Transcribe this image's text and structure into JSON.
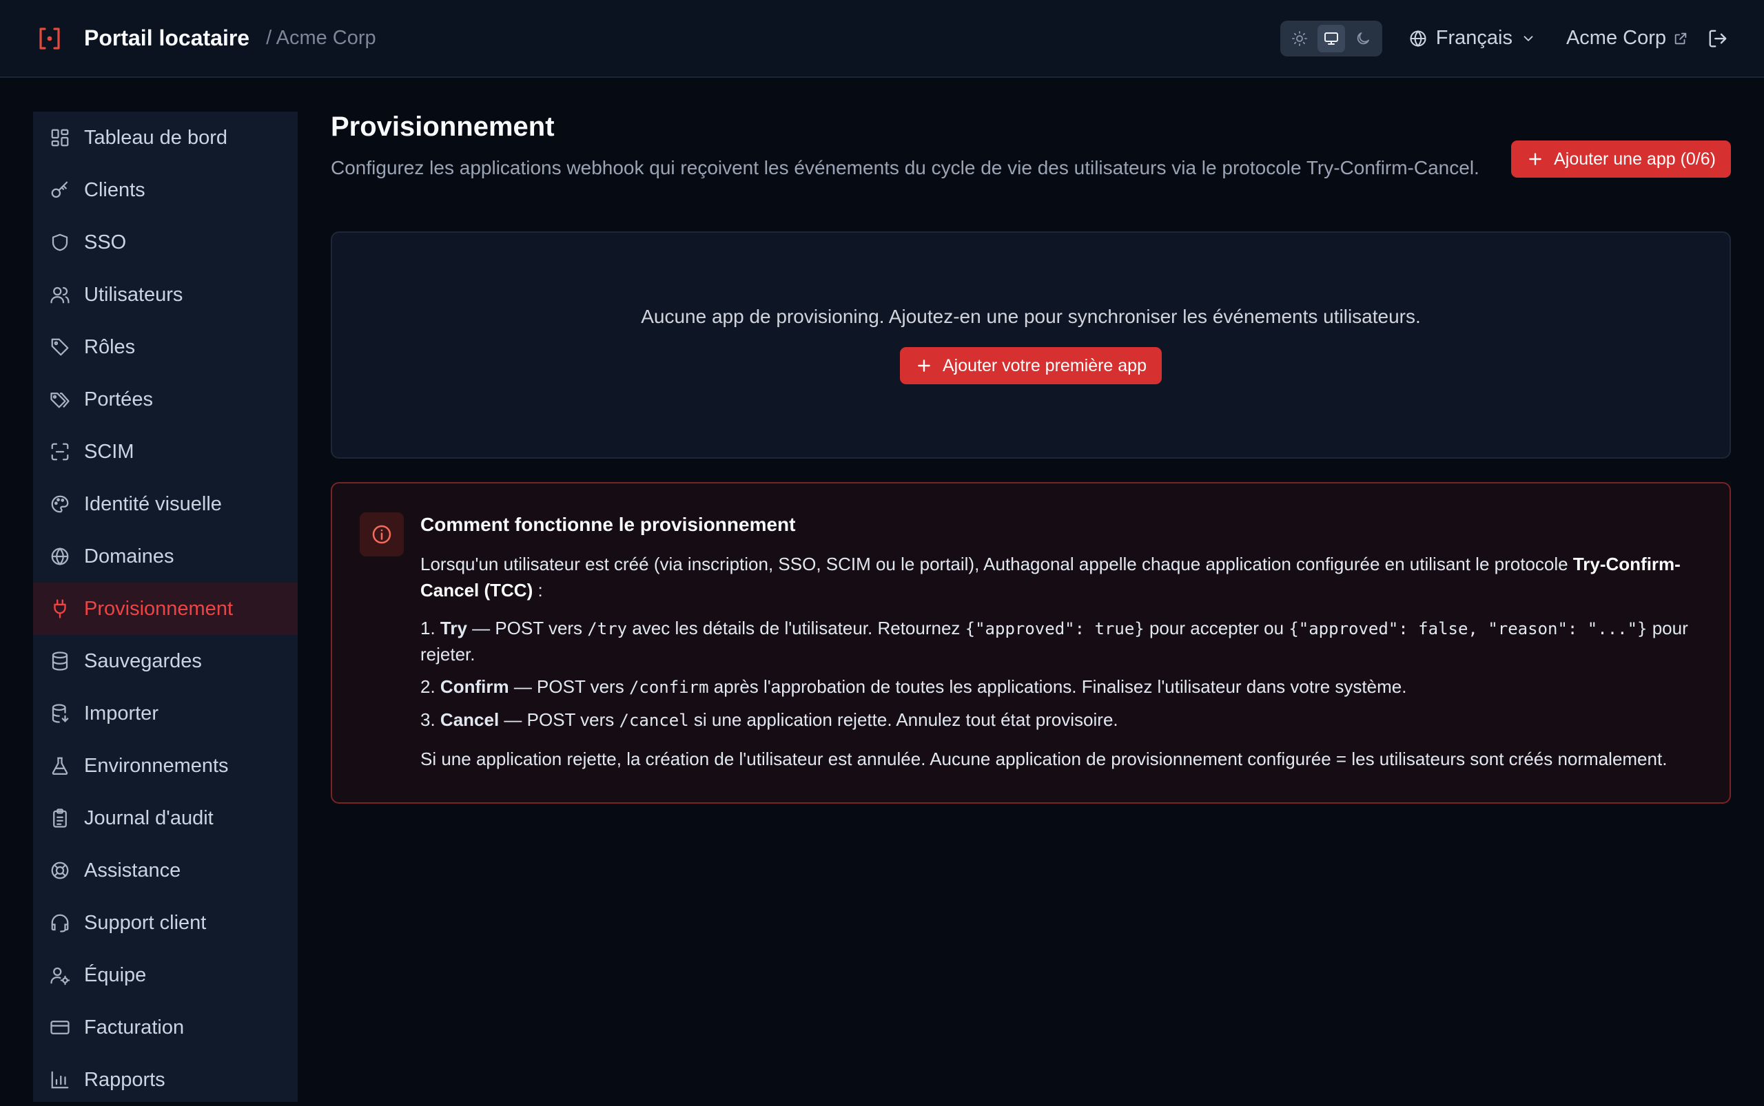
{
  "header": {
    "app_title": "Portail locataire",
    "breadcrumb": "/ Acme Corp",
    "language": "Français",
    "org_link": "Acme Corp",
    "theme_options": [
      "light",
      "system",
      "dark"
    ],
    "theme_selected": "system"
  },
  "sidebar": {
    "items": [
      {
        "label": "Tableau de bord",
        "icon": "dashboard-icon"
      },
      {
        "label": "Clients",
        "icon": "key-icon"
      },
      {
        "label": "SSO",
        "icon": "shield-icon"
      },
      {
        "label": "Utilisateurs",
        "icon": "users-icon"
      },
      {
        "label": "Rôles",
        "icon": "tag-icon"
      },
      {
        "label": "Portées",
        "icon": "tags-icon"
      },
      {
        "label": "SCIM",
        "icon": "scan-icon"
      },
      {
        "label": "Identité visuelle",
        "icon": "palette-icon"
      },
      {
        "label": "Domaines",
        "icon": "globe-icon"
      },
      {
        "label": "Provisionnement",
        "icon": "plug-icon",
        "active": true
      },
      {
        "label": "Sauvegardes",
        "icon": "database-icon"
      },
      {
        "label": "Importer",
        "icon": "database-import-icon"
      },
      {
        "label": "Environnements",
        "icon": "flask-icon"
      },
      {
        "label": "Journal d'audit",
        "icon": "clipboard-icon"
      },
      {
        "label": "Assistance",
        "icon": "lifebuoy-icon"
      },
      {
        "label": "Support client",
        "icon": "headset-icon"
      },
      {
        "label": "Équipe",
        "icon": "user-cog-icon"
      },
      {
        "label": "Facturation",
        "icon": "credit-card-icon"
      },
      {
        "label": "Rapports",
        "icon": "bar-chart-icon"
      }
    ]
  },
  "main": {
    "title": "Provisionnement",
    "description": "Configurez les applications webhook qui reçoivent les événements du cycle de vie des utilisateurs via le protocole Try-Confirm-Cancel.",
    "add_button": "Ajouter une app (0/6)",
    "empty_state": {
      "text": "Aucune app de provisioning. Ajoutez-en une pour synchroniser les événements utilisateurs.",
      "button": "Ajouter votre première app"
    },
    "info": {
      "title": "Comment fonctionne le provisionnement",
      "intro": "Lorsqu'un utilisateur est créé (via inscription, SSO, SCIM ou le portail), Authagonal appelle chaque application configurée en utilisant le protocole ",
      "intro_bold": "Try-Confirm-Cancel (TCC)",
      "intro_end": " :",
      "steps": [
        {
          "num": "1.",
          "name": "Try",
          "parts": [
            " — POST vers ",
            "/try",
            " avec les détails de l'utilisateur. Retournez ",
            "{\"approved\": true}",
            " pour accepter ou ",
            "{\"approved\": false, \"reason\": \"...\"}",
            " pour rejeter."
          ]
        },
        {
          "num": "2.",
          "name": "Confirm",
          "parts": [
            " — POST vers ",
            "/confirm",
            " après l'approbation de toutes les applications. Finalisez l'utilisateur dans votre système."
          ]
        },
        {
          "num": "3.",
          "name": "Cancel",
          "parts": [
            " — POST vers ",
            "/cancel",
            " si une application rejette. Annulez tout état provisoire."
          ]
        }
      ],
      "footer": "Si une application rejette, la création de l'utilisateur est annulée. Aucune application de provisionnement configurée = les utilisateurs sont créés normalement."
    }
  },
  "colors": {
    "accent": "#d63031",
    "background": "#060a13",
    "sidebar": "#111a2b",
    "active_text": "#ef4444"
  }
}
